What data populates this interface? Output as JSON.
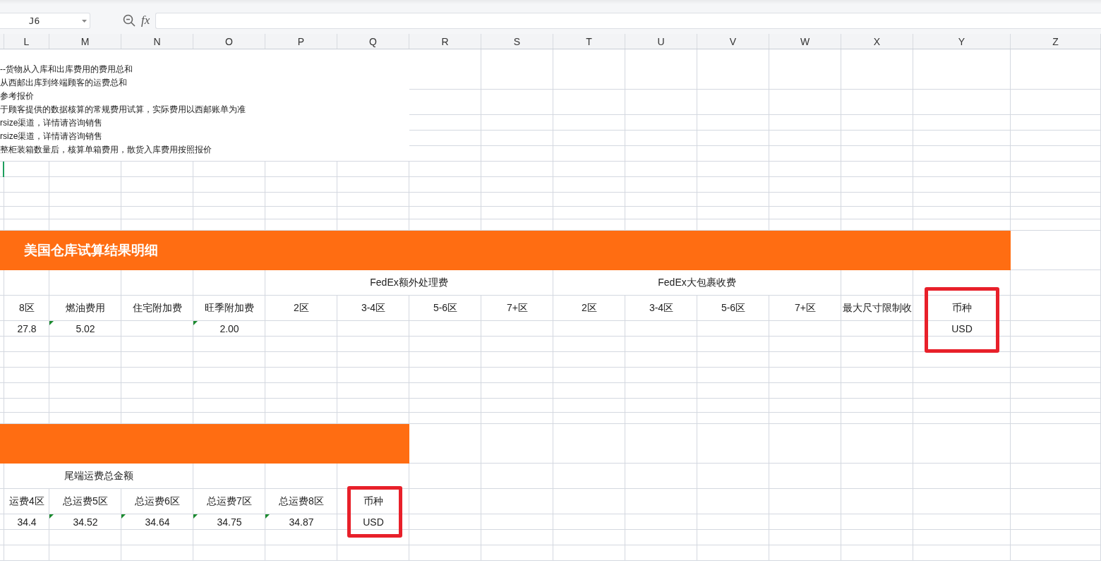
{
  "name_box": {
    "value": "J6"
  },
  "formula_bar": {
    "function_label": "fx"
  },
  "columns": [
    "L",
    "M",
    "N",
    "O",
    "P",
    "Q",
    "R",
    "S",
    "T",
    "U",
    "V",
    "W",
    "X",
    "Y",
    "Z"
  ],
  "notes": [
    "--货物从入库和出库费用的费用总和",
    "从西邮出库到终端顾客的运费总和",
    "参考报价",
    "于顾客提供的数据核算的常规费用试算，实际费用以西邮账单为准",
    "rsize渠道，详情请咨询销售",
    "rsize渠道，详情请咨询销售",
    "整柜装箱数量后，核算单箱费用，散货入库费用按照报价"
  ],
  "tables": [
    {
      "title": "美国仓库试算结果明细",
      "group_headers": [
        "FedEx额外处理费",
        "FedEx大包裹收费"
      ],
      "headers": [
        "8区",
        "燃油费用",
        "住宅附加费",
        "旺季附加费",
        "2区",
        "3-4区",
        "5-6区",
        "7+区",
        "2区",
        "3-4区",
        "5-6区",
        "7+区",
        "最大尺寸限制收",
        "币种"
      ],
      "row": [
        {
          "text": "27.8",
          "flagged": false
        },
        {
          "text": "5.02",
          "flagged": true
        },
        {
          "text": "2.00",
          "flagged": true
        },
        {
          "text": "USD",
          "flagged": false
        }
      ],
      "highlighted": true
    },
    {
      "subtitle": "尾端运费总金额",
      "headers": [
        "运费4区",
        "总运费5区",
        "总运费6区",
        "总运费7区",
        "总运费8区",
        "币种"
      ],
      "row": [
        {
          "text": "34.4",
          "flagged": false
        },
        {
          "text": "34.52",
          "flagged": true
        },
        {
          "text": "34.64",
          "flagged": true
        },
        {
          "text": "34.75",
          "flagged": true
        },
        {
          "text": "34.87",
          "flagged": true
        },
        {
          "text": "USD",
          "flagged": false
        }
      ],
      "highlighted": true
    }
  ]
}
